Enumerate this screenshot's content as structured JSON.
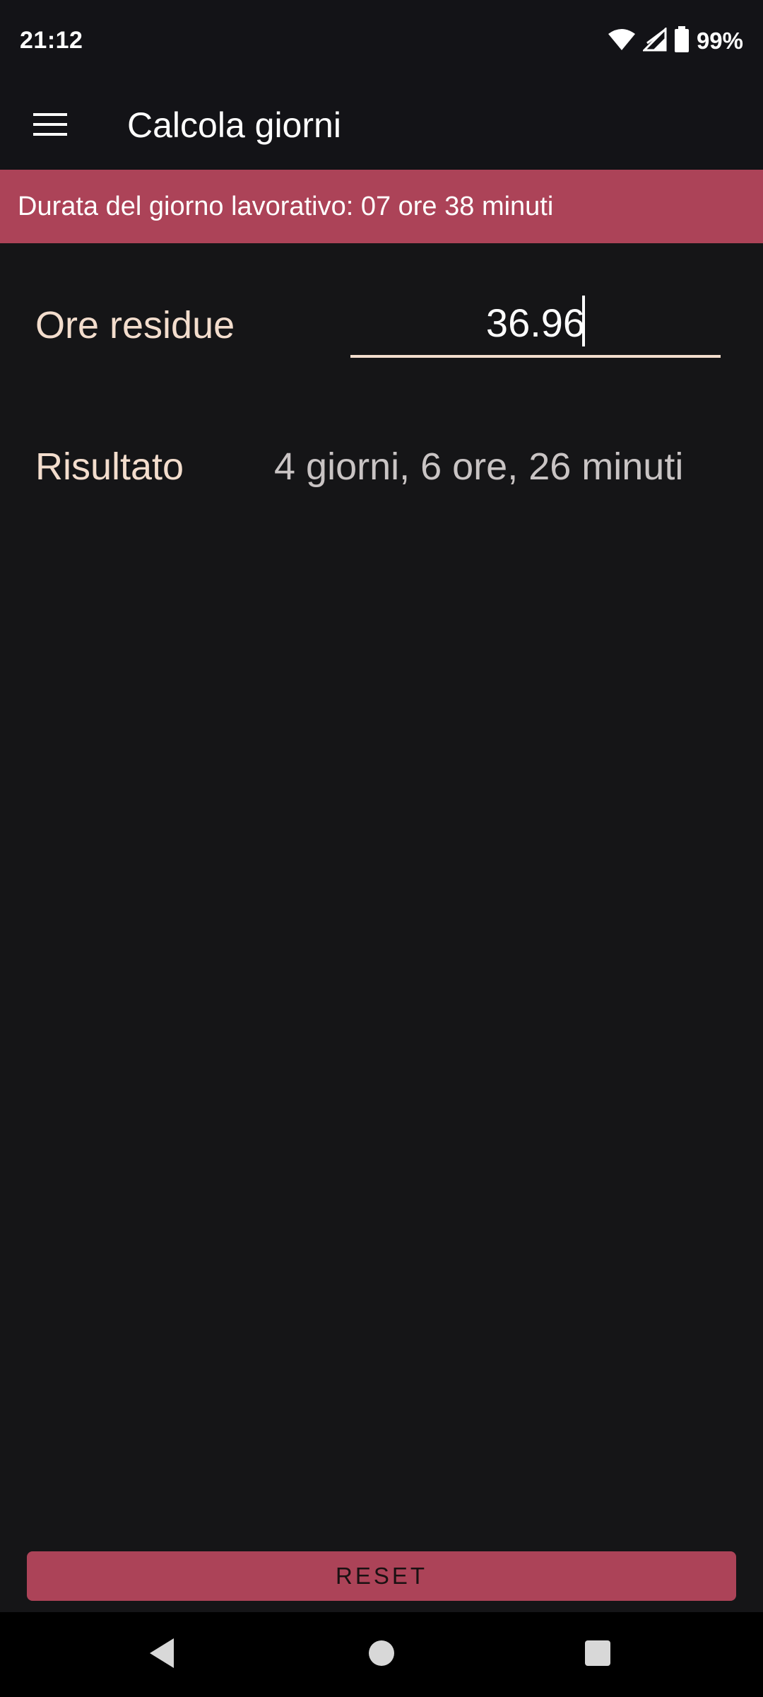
{
  "status_bar": {
    "time": "21:12",
    "battery_percent": "99%",
    "icons": [
      "wifi-icon",
      "signal-icon",
      "battery-icon"
    ]
  },
  "app_bar": {
    "title": "Calcola giorni",
    "menu_icon": "hamburger-menu-icon"
  },
  "banner": {
    "text": "Durata del giorno lavorativo: 07 ore 38 minuti"
  },
  "form": {
    "remaining_hours_label": "Ore residue",
    "remaining_hours_value": "36.96",
    "result_label": "Risultato",
    "result_value": "4 giorni, 6 ore, 26 minuti"
  },
  "actions": {
    "reset_label": "RESET"
  },
  "nav_bar": {
    "icons": [
      "back-icon",
      "home-icon",
      "recents-icon"
    ]
  },
  "colors": {
    "background": "#151517",
    "bar_background": "#131317",
    "accent": "#ac4358",
    "label_text": "#f3ddcd",
    "result_text": "#c9c4c4"
  }
}
